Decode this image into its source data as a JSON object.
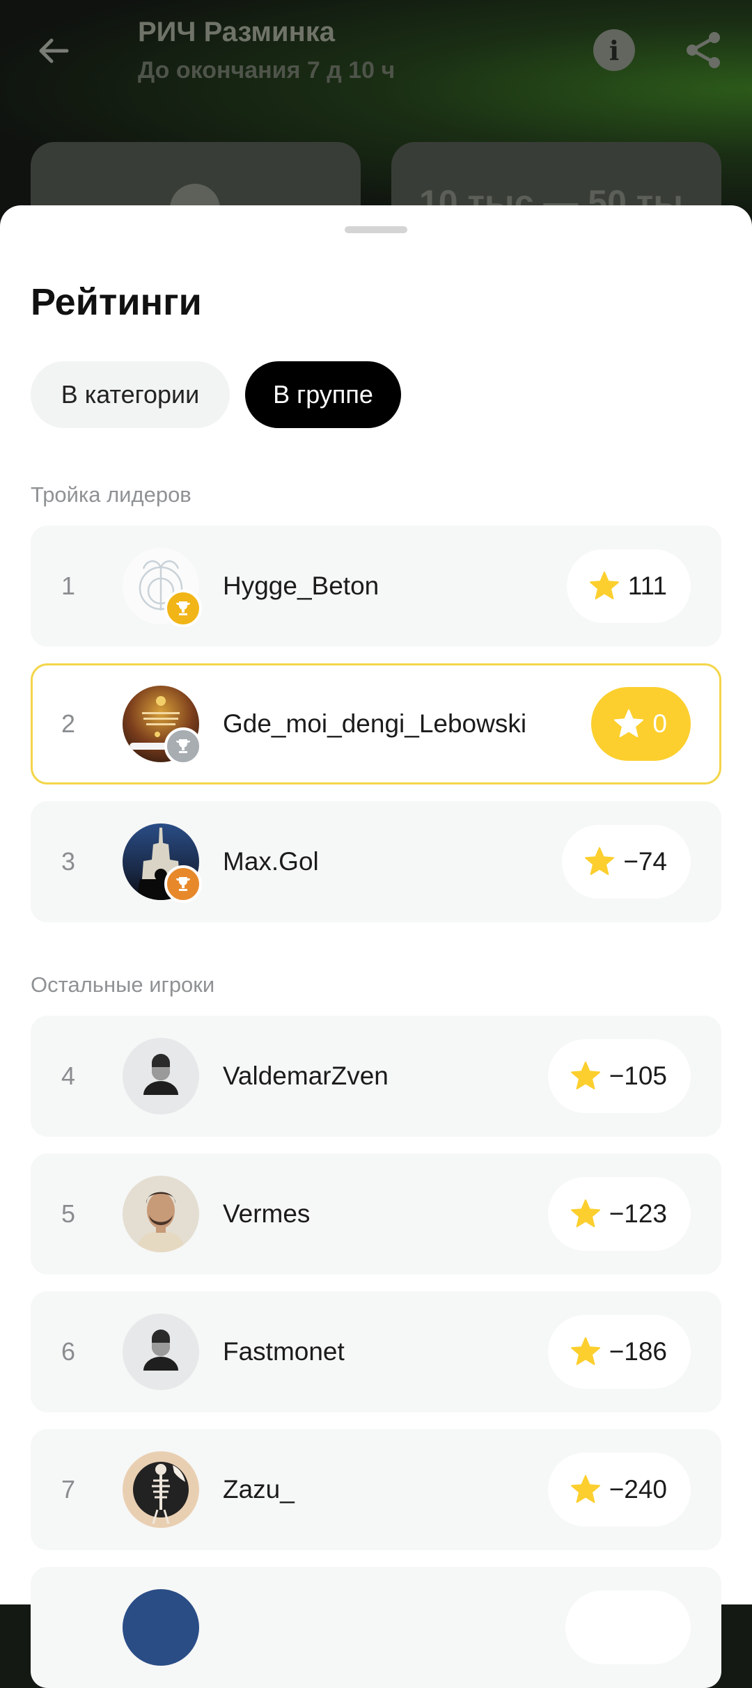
{
  "header": {
    "title": "РИЧ Разминка",
    "subtitle": "До окончания 7 д 10 ч",
    "card_text": "10 тыс — 50 ты"
  },
  "sheet": {
    "title": "Рейтинги",
    "tabs": [
      {
        "label": "В категории",
        "active": false
      },
      {
        "label": "В группе",
        "active": true
      }
    ],
    "leaders_label": "Тройка лидеров",
    "others_label": "Остальные игроки",
    "leaders": [
      {
        "rank": "1",
        "name": "Hygge_Beton",
        "score": "111",
        "trophy": "gold"
      },
      {
        "rank": "2",
        "name": "Gde_moi_dengi_Lebowski",
        "score": "0",
        "trophy": "silver",
        "current_user": true
      },
      {
        "rank": "3",
        "name": "Max.Gol",
        "score": "−74",
        "trophy": "bronze"
      }
    ],
    "others": [
      {
        "rank": "4",
        "name": "ValdemarZven",
        "score": "−105"
      },
      {
        "rank": "5",
        "name": "Vermes",
        "score": "−123"
      },
      {
        "rank": "6",
        "name": "Fastmonet",
        "score": "−186"
      },
      {
        "rank": "7",
        "name": "Zazu_",
        "score": "−240"
      }
    ]
  },
  "colors": {
    "accent": "#fccf2e",
    "highlight_border": "#f3d64a",
    "gold": "#f1b517",
    "silver": "#a8adb2",
    "bronze": "#e7892b"
  }
}
